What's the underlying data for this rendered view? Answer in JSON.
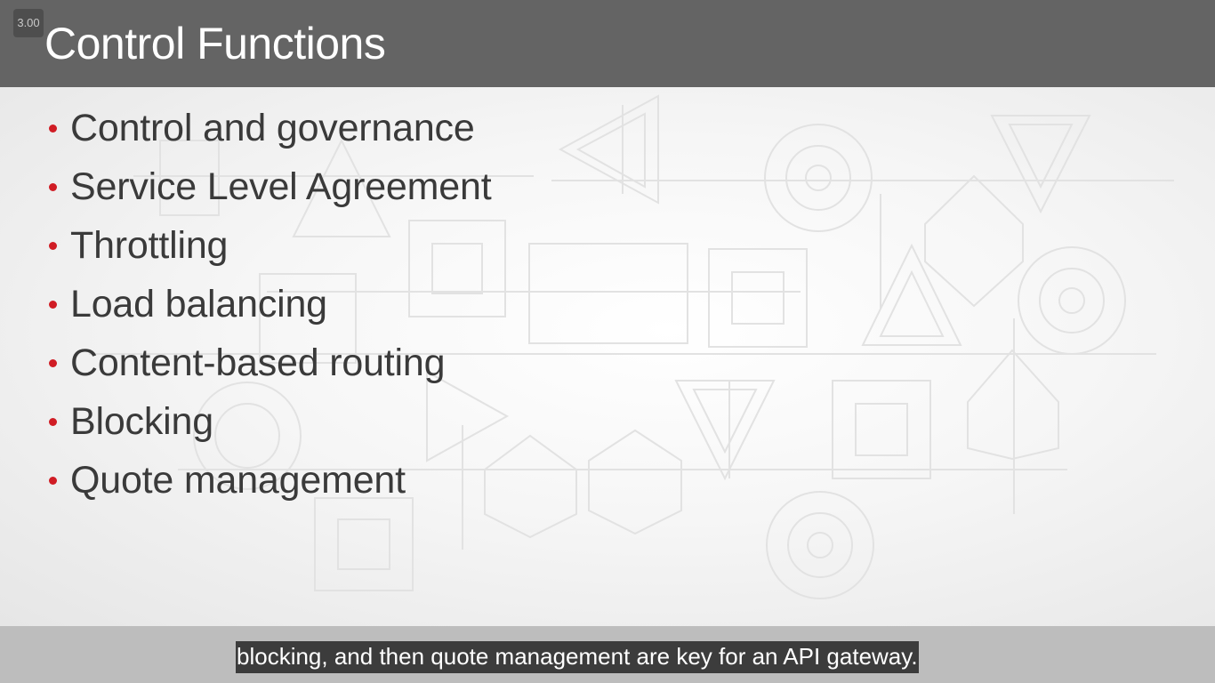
{
  "player": {
    "speed": "3.00"
  },
  "slide": {
    "title": "Control Functions",
    "bullets": [
      "Control and governance",
      "Service Level Agreement",
      "Throttling",
      "Load balancing",
      "Content-based routing",
      "Blocking",
      "Quote management"
    ],
    "accent_color": "#d01c24",
    "title_bar_color": "#646464"
  },
  "caption": {
    "text": "blocking, and then quote management are key for an API gateway."
  }
}
